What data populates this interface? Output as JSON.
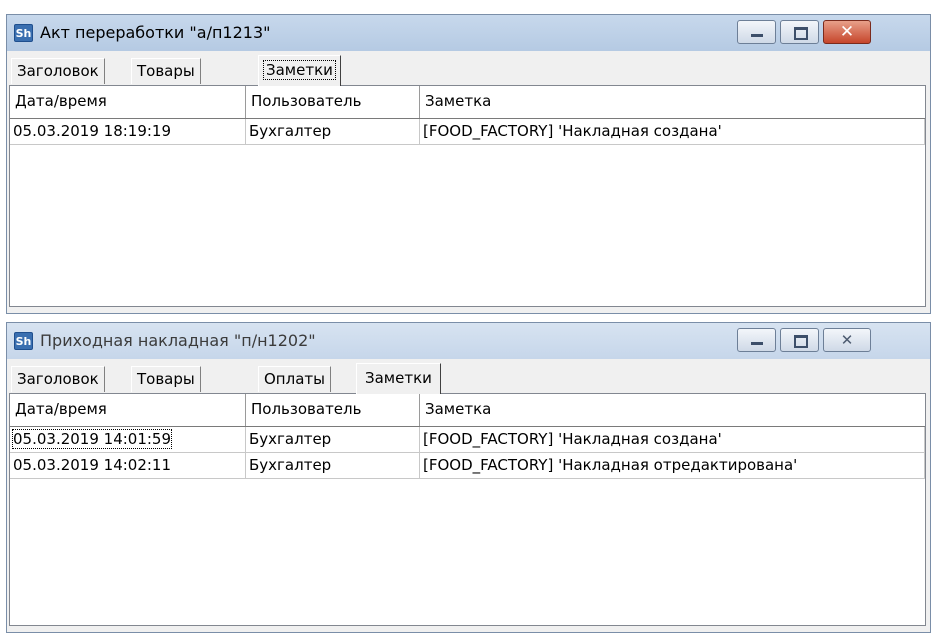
{
  "windows": [
    {
      "icon_label": "Sh",
      "title": "Акт переработки \"а/п1213\"",
      "tabs": [
        "Заголовок",
        "Товары",
        "Заметки"
      ],
      "active_tab": "Заметки",
      "columns": [
        "Дата/время",
        "Пользователь",
        "Заметка"
      ],
      "rows": [
        [
          "05.03.2019 18:19:19",
          "Бухгалтер",
          "[FOOD_FACTORY] 'Накладная создана'"
        ]
      ],
      "controls": {
        "minimize": "minimize-icon",
        "maximize": "maximize-icon",
        "close": "close-icon"
      }
    },
    {
      "icon_label": "Sh",
      "title": "Приходная накладная \"п/н1202\"",
      "tabs": [
        "Заголовок",
        "Товары",
        "Оплаты",
        "Заметки"
      ],
      "active_tab": "Заметки",
      "columns": [
        "Дата/время",
        "Пользователь",
        "Заметка"
      ],
      "rows": [
        [
          "05.03.2019 14:01:59",
          "Бухгалтер",
          "[FOOD_FACTORY] 'Накладная создана'"
        ],
        [
          "05.03.2019 14:02:11",
          "Бухгалтер",
          "[FOOD_FACTORY] 'Накладная отредактирована'"
        ]
      ],
      "controls": {
        "minimize": "minimize-icon",
        "maximize": "maximize-icon",
        "close": "close-icon"
      }
    }
  ]
}
